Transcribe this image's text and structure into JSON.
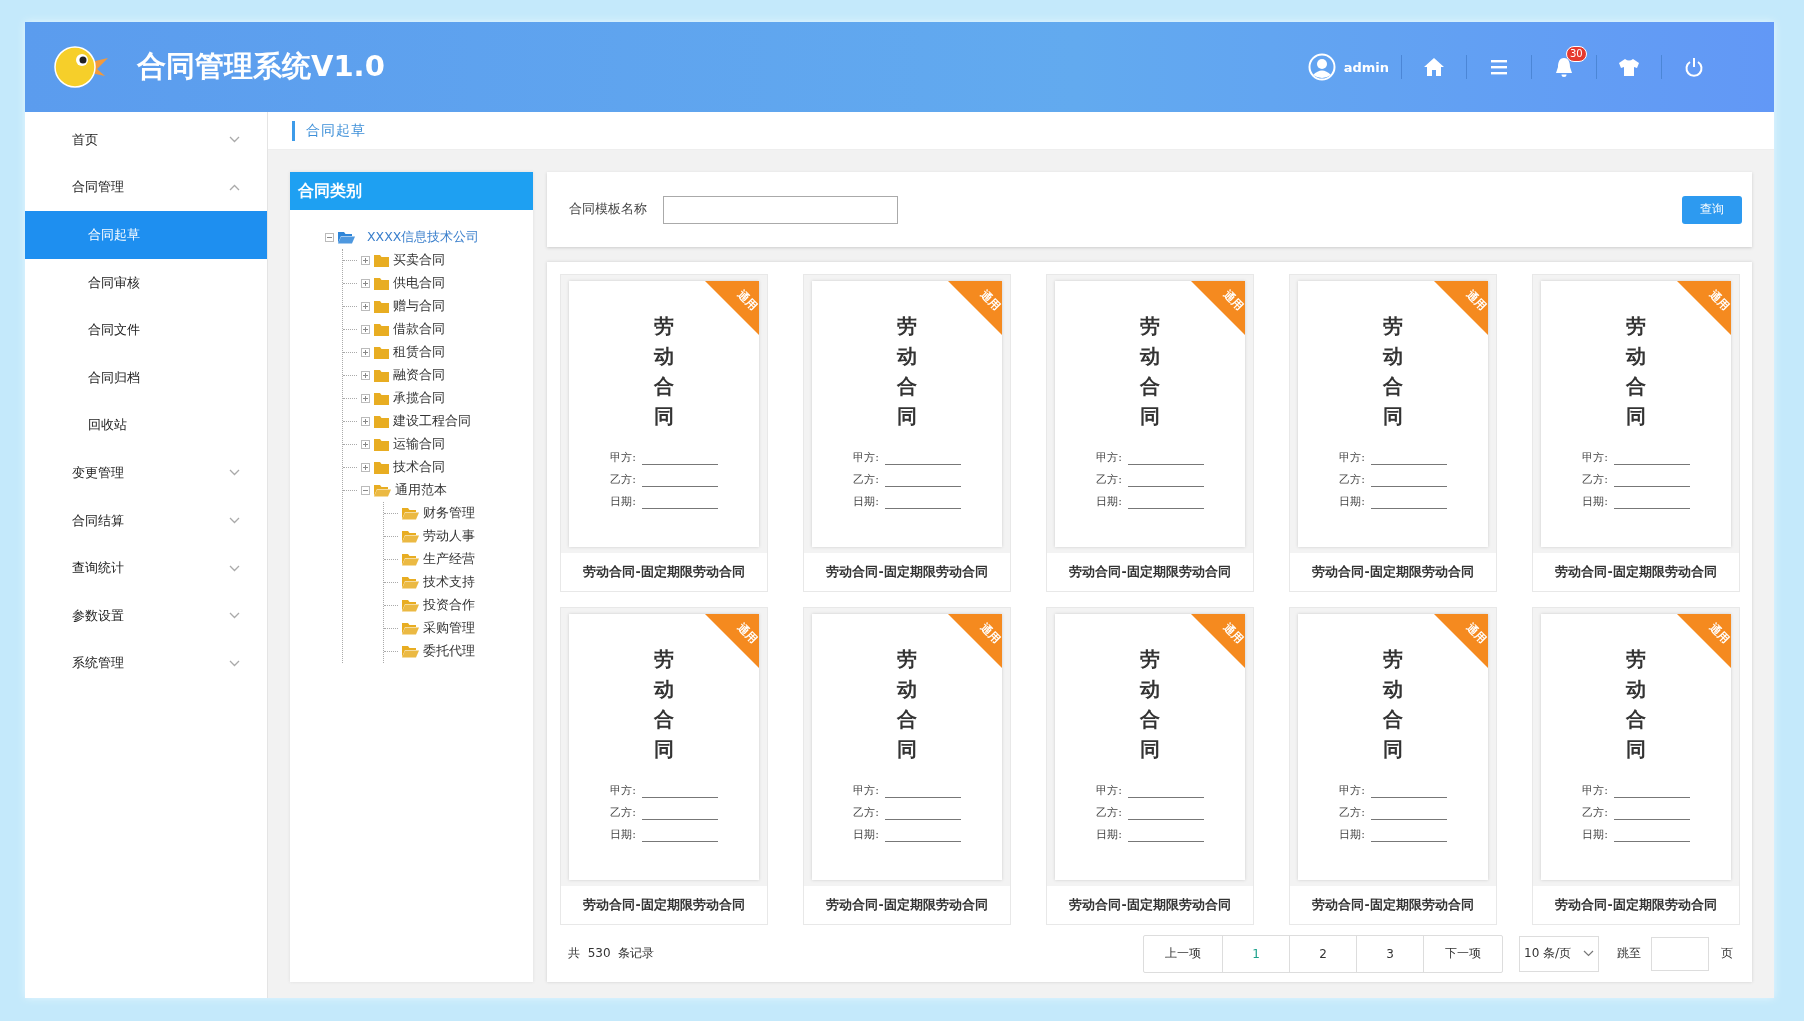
{
  "header": {
    "title": "合同管理系统V1.0",
    "user": "admin",
    "notification_count": "30"
  },
  "sidebar": {
    "items": [
      {
        "label": "首页",
        "expanded": false,
        "selected": false
      },
      {
        "label": "合同管理",
        "expanded": true,
        "selected": false,
        "children": [
          {
            "label": "合同起草",
            "selected": true
          },
          {
            "label": "合同审核",
            "selected": false
          },
          {
            "label": "合同文件",
            "selected": false
          },
          {
            "label": "合同归档",
            "selected": false
          },
          {
            "label": "回收站",
            "selected": false
          }
        ]
      },
      {
        "label": "变更管理",
        "expanded": false,
        "selected": false
      },
      {
        "label": "合同结算",
        "expanded": false,
        "selected": false
      },
      {
        "label": "查询统计",
        "expanded": false,
        "selected": false
      },
      {
        "label": "参数设置",
        "expanded": false,
        "selected": false
      },
      {
        "label": "系统管理",
        "expanded": false,
        "selected": false
      }
    ]
  },
  "breadcrumb": "合同起草",
  "tree": {
    "title": "合同类别",
    "root": {
      "label": "XXXX信息技术公司",
      "expanded": true,
      "children": [
        {
          "label": "买卖合同",
          "expanded": false
        },
        {
          "label": "供电合同",
          "expanded": false
        },
        {
          "label": "赠与合同",
          "expanded": false
        },
        {
          "label": "借款合同",
          "expanded": false
        },
        {
          "label": "租赁合同",
          "expanded": false
        },
        {
          "label": "融资合同",
          "expanded": false
        },
        {
          "label": "承揽合同",
          "expanded": false
        },
        {
          "label": "建设工程合同",
          "expanded": false
        },
        {
          "label": "运输合同",
          "expanded": false
        },
        {
          "label": "技术合同",
          "expanded": false
        },
        {
          "label": "通用范本",
          "expanded": true,
          "children": [
            {
              "label": "财务管理"
            },
            {
              "label": "劳动人事"
            },
            {
              "label": "生产经营"
            },
            {
              "label": "技术支持"
            },
            {
              "label": "投资合作"
            },
            {
              "label": "采购管理"
            },
            {
              "label": "委托代理"
            }
          ]
        }
      ]
    }
  },
  "search": {
    "label": "合同模板名称",
    "button": "查询"
  },
  "templates": [
    {
      "title": "劳动合同",
      "badge": "通用",
      "fields": [
        "甲方:",
        "乙方:",
        "日期:"
      ],
      "caption": "劳动合同-固定期限劳动合同"
    },
    {
      "title": "劳动合同",
      "badge": "通用",
      "fields": [
        "甲方:",
        "乙方:",
        "日期:"
      ],
      "caption": "劳动合同-固定期限劳动合同"
    },
    {
      "title": "劳动合同",
      "badge": "通用",
      "fields": [
        "甲方:",
        "乙方:",
        "日期:"
      ],
      "caption": "劳动合同-固定期限劳动合同"
    },
    {
      "title": "劳动合同",
      "badge": "通用",
      "fields": [
        "甲方:",
        "乙方:",
        "日期:"
      ],
      "caption": "劳动合同-固定期限劳动合同"
    },
    {
      "title": "劳动合同",
      "badge": "通用",
      "fields": [
        "甲方:",
        "乙方:",
        "日期:"
      ],
      "caption": "劳动合同-固定期限劳动合同"
    },
    {
      "title": "劳动合同",
      "badge": "通用",
      "fields": [
        "甲方:",
        "乙方:",
        "日期:"
      ],
      "caption": "劳动合同-固定期限劳动合同"
    },
    {
      "title": "劳动合同",
      "badge": "通用",
      "fields": [
        "甲方:",
        "乙方:",
        "日期:"
      ],
      "caption": "劳动合同-固定期限劳动合同"
    },
    {
      "title": "劳动合同",
      "badge": "通用",
      "fields": [
        "甲方:",
        "乙方:",
        "日期:"
      ],
      "caption": "劳动合同-固定期限劳动合同"
    },
    {
      "title": "劳动合同",
      "badge": "通用",
      "fields": [
        "甲方:",
        "乙方:",
        "日期:"
      ],
      "caption": "劳动合同-固定期限劳动合同"
    },
    {
      "title": "劳动合同",
      "badge": "通用",
      "fields": [
        "甲方:",
        "乙方:",
        "日期:"
      ],
      "caption": "劳动合同-固定期限劳动合同"
    }
  ],
  "pagination": {
    "total": "共  530  条记录",
    "prev": "上一项",
    "pages": [
      {
        "label": "1",
        "selected": true
      },
      {
        "label": "2",
        "selected": false
      },
      {
        "label": "3",
        "selected": false
      }
    ],
    "next": "下一项",
    "page_size": "10 条/页",
    "jump_label": "跳至",
    "jump_suffix": "页"
  }
}
